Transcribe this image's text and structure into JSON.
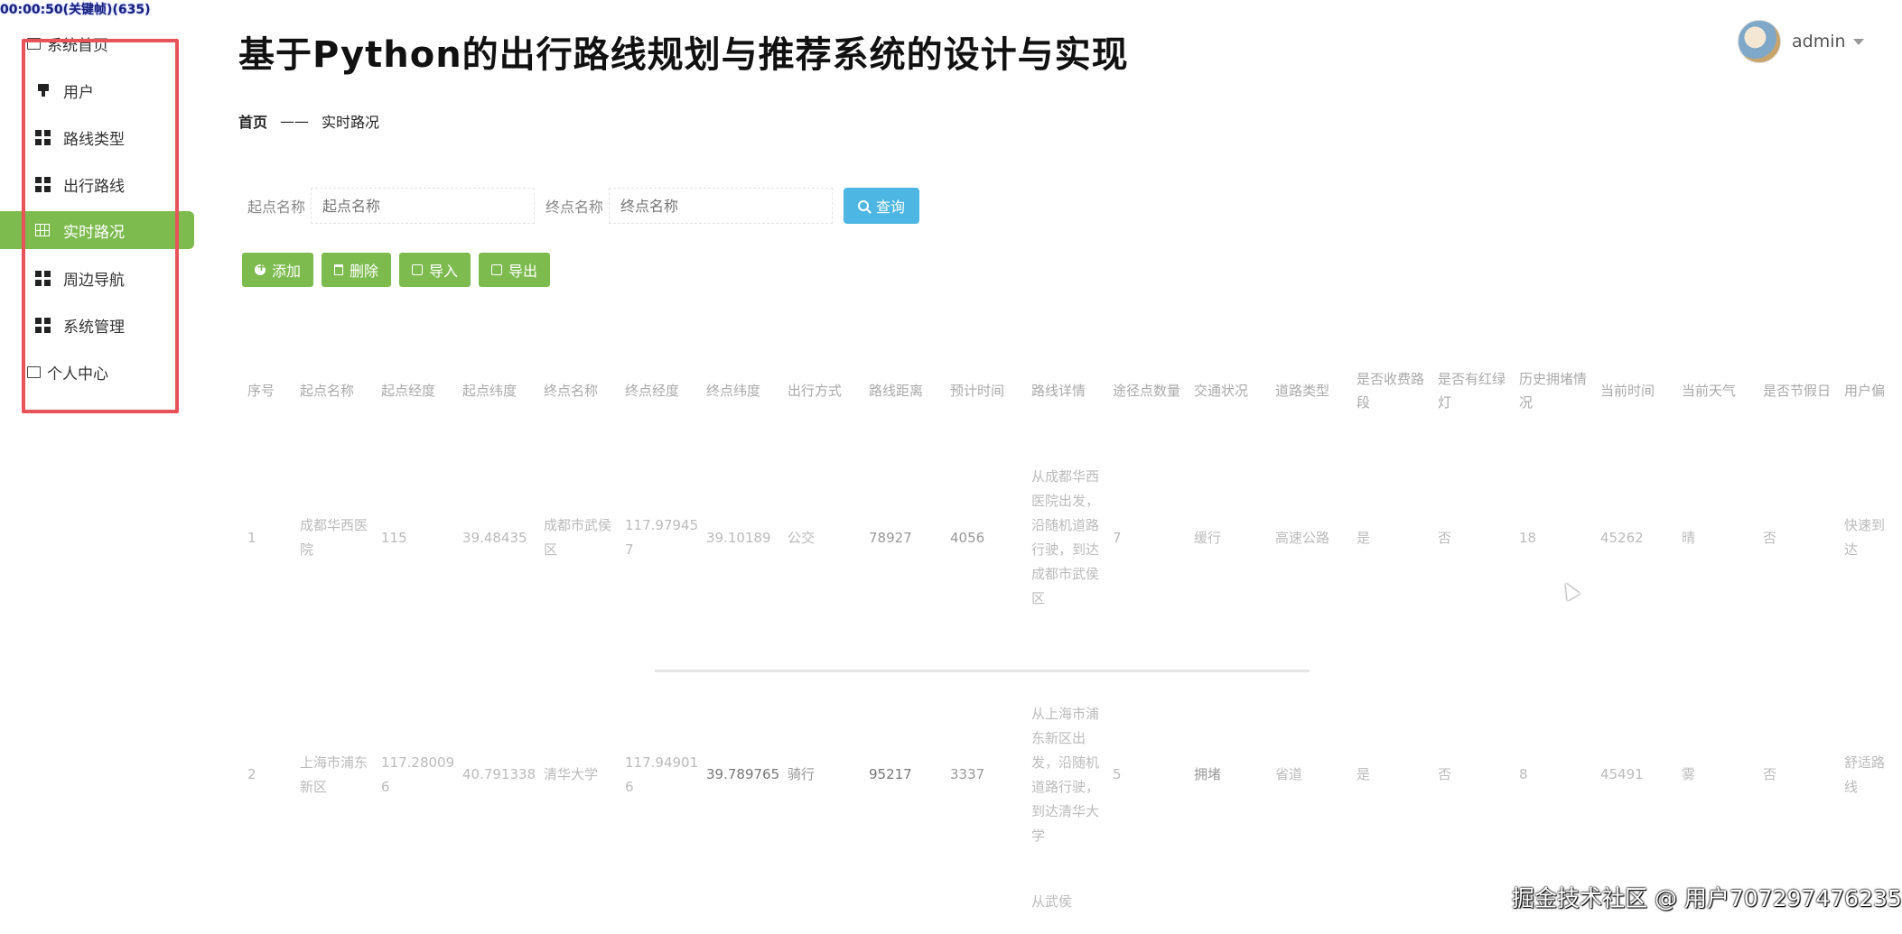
{
  "recording_timer": "00:00:50(关键帧)(635)",
  "header": {
    "title": "基于Python的出行路线规划与推荐系统的设计与实现",
    "username": "admin"
  },
  "sidebar": {
    "items": [
      {
        "label": "系统首页",
        "icon": "home-square-icon"
      },
      {
        "label": "用户",
        "icon": "user-icon"
      },
      {
        "label": "路线类型",
        "icon": "grid-icon"
      },
      {
        "label": "出行路线",
        "icon": "grid-icon"
      },
      {
        "label": "实时路况",
        "icon": "table-icon",
        "active": true
      },
      {
        "label": "周边导航",
        "icon": "grid-icon"
      },
      {
        "label": "系统管理",
        "icon": "grid-icon"
      },
      {
        "label": "个人中心",
        "icon": "square-icon"
      }
    ]
  },
  "breadcrumb": {
    "home": "首页",
    "separator": "——",
    "current": "实时路况"
  },
  "search": {
    "start_label": "起点名称",
    "start_placeholder": "起点名称",
    "end_label": "终点名称",
    "end_placeholder": "终点名称",
    "query_label": "查询"
  },
  "actions": {
    "add": "添加",
    "delete": "删除",
    "import": "导入",
    "export": "导出"
  },
  "table": {
    "headers": [
      "序号",
      "起点名称",
      "起点经度",
      "起点纬度",
      "终点名称",
      "终点经度",
      "终点纬度",
      "出行方式",
      "路线距离",
      "预计时间",
      "路线详情",
      "途径点数量",
      "交通状况",
      "道路类型",
      "是否收费路段",
      "是否有红绿灯",
      "历史拥堵情况",
      "当前时间",
      "当前天气",
      "是否节假日",
      "用户偏"
    ],
    "rows": [
      [
        "1",
        "成都华西医院",
        "115",
        "39.48435",
        "成都市武侯区",
        "117.979457",
        "39.10189",
        "公交",
        "78927",
        "4056",
        "从成都华西医院出发，沿随机道路行驶，到达成都市武侯区",
        "7",
        "缓行",
        "高速公路",
        "是",
        "否",
        "18",
        "45262",
        "晴",
        "否",
        "快速到达"
      ],
      [
        "2",
        "上海市浦东新区",
        "117.280096",
        "40.791338",
        "清华大学",
        "117.949016",
        "39.789765",
        "骑行",
        "95217",
        "3337",
        "从上海市浦东新区出发，沿随机道路行驶，到达清华大学",
        "5",
        "拥堵",
        "省道",
        "是",
        "否",
        "8",
        "45491",
        "雾",
        "否",
        "舒适路线"
      ]
    ],
    "partial_next": "从武侯"
  },
  "watermark": "掘金技术社区 @ 用户707297476235",
  "colors": {
    "accent_green": "#7dbb4f",
    "query_blue": "#4db6e2",
    "frame_red": "#e8535a"
  }
}
